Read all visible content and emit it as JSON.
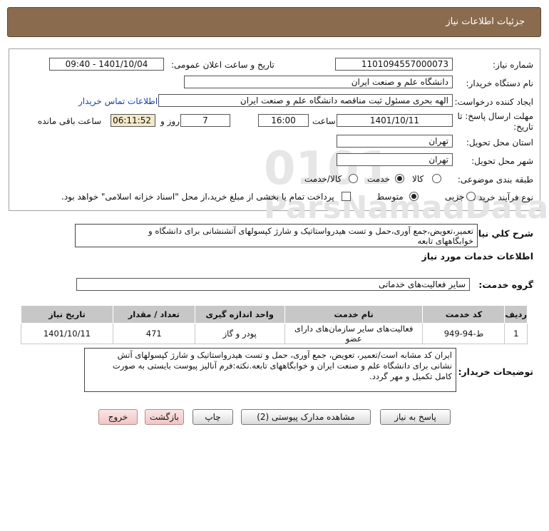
{
  "header": {
    "title": "جزئیات اطلاعات نیاز"
  },
  "form": {
    "need_number": {
      "label": "شماره نیاز:",
      "value": "1101094557000073"
    },
    "announce": {
      "label": "تاریخ و ساعت اعلان عمومی:",
      "value": "1401/10/04 - 09:40"
    },
    "buyer_org": {
      "label": "نام دستگاه خریدار:",
      "value": "دانشگاه علم و صنعت ایران"
    },
    "requester": {
      "label": "ایجاد کننده درخواست:",
      "value": "الهه بحری مسئول ثبت مناقصه دانشگاه علم و صنعت ایران",
      "contact_link": "اطلاعات تماس خریدار"
    },
    "deadline": {
      "label_line1": "مهلت ارسال پاسخ: تا",
      "label_line2": "تاریخ:",
      "date": "1401/10/11",
      "time_label": "ساعت",
      "time": "16:00",
      "days": "7",
      "days_label": "روز و",
      "remaining": "06:11:52",
      "remaining_label": "ساعت باقی مانده"
    },
    "province": {
      "label": "استان محل تحویل:",
      "value": "تهران"
    },
    "city": {
      "label": "شهر محل تحویل:",
      "value": "تهران"
    },
    "category": {
      "label": "طبقه بندی موضوعی:",
      "options": [
        "کالا",
        "خدمت",
        "کالا/خدمت"
      ],
      "selected": "خدمت"
    },
    "process": {
      "label": "نوع فرآیند خرید :",
      "options": [
        "جزیی",
        "متوسط"
      ],
      "selected": "متوسط",
      "payment_note": "پرداخت تمام یا بخشی از مبلغ خرید،از محل \"اسناد خزانه اسلامی\" خواهد بود."
    }
  },
  "summary": {
    "label": "شرح کلي نياز:",
    "text_line1": "تعمیر،تعویض،جمع آوری،حمل و تست هیدرواستاتیک و شارژ کپسولهای آتشنشانی برای دانشگاه و",
    "text_line2": "خوابگاههای تابعه"
  },
  "services": {
    "section_title": "اطلاعات خدمات مورد نياز",
    "group_label": "گروه خدمت:",
    "group_value": "سایر فعالیت‌های خدماتی",
    "columns": [
      "ردیف",
      "کد خدمت",
      "نام خدمت",
      "واحد اندازه گیری",
      "تعداد / مقدار",
      "تاریخ نیاز"
    ],
    "rows": [
      [
        "1",
        "ط-94-949",
        "فعالیت‌های سایر سازمان‌های دارای عضو",
        "پودر و گاز",
        "471",
        "1401/10/11"
      ]
    ]
  },
  "buyer_desc": {
    "label": "توضیحات خریدار:",
    "line1": "ایران کد مشابه است/تعمیر، تعویض، جمع آوری، حمل و تست هیدرواستاتیک و شارژ کپسولهای آتش",
    "line2": "نشانی برای دانشگاه علم و صنعت ایران و خوابگاههای تابعه.نکته:فرم آنالیز پیوست بایستی به صورت",
    "line3": "کامل تکمیل و مهر گردد."
  },
  "buttons": {
    "reply": "پاسخ به نیاز",
    "view_docs": "مشاهده مدارک پیوستی (2)",
    "print": "چاپ",
    "back": "بازگشت",
    "exit": "خروج"
  },
  "colors": {
    "header_bg": "#8b6b4e",
    "table_header_bg": "#c7c7c7",
    "remaining_bg": "#f2e9c8",
    "link": "#1a3fb0"
  }
}
